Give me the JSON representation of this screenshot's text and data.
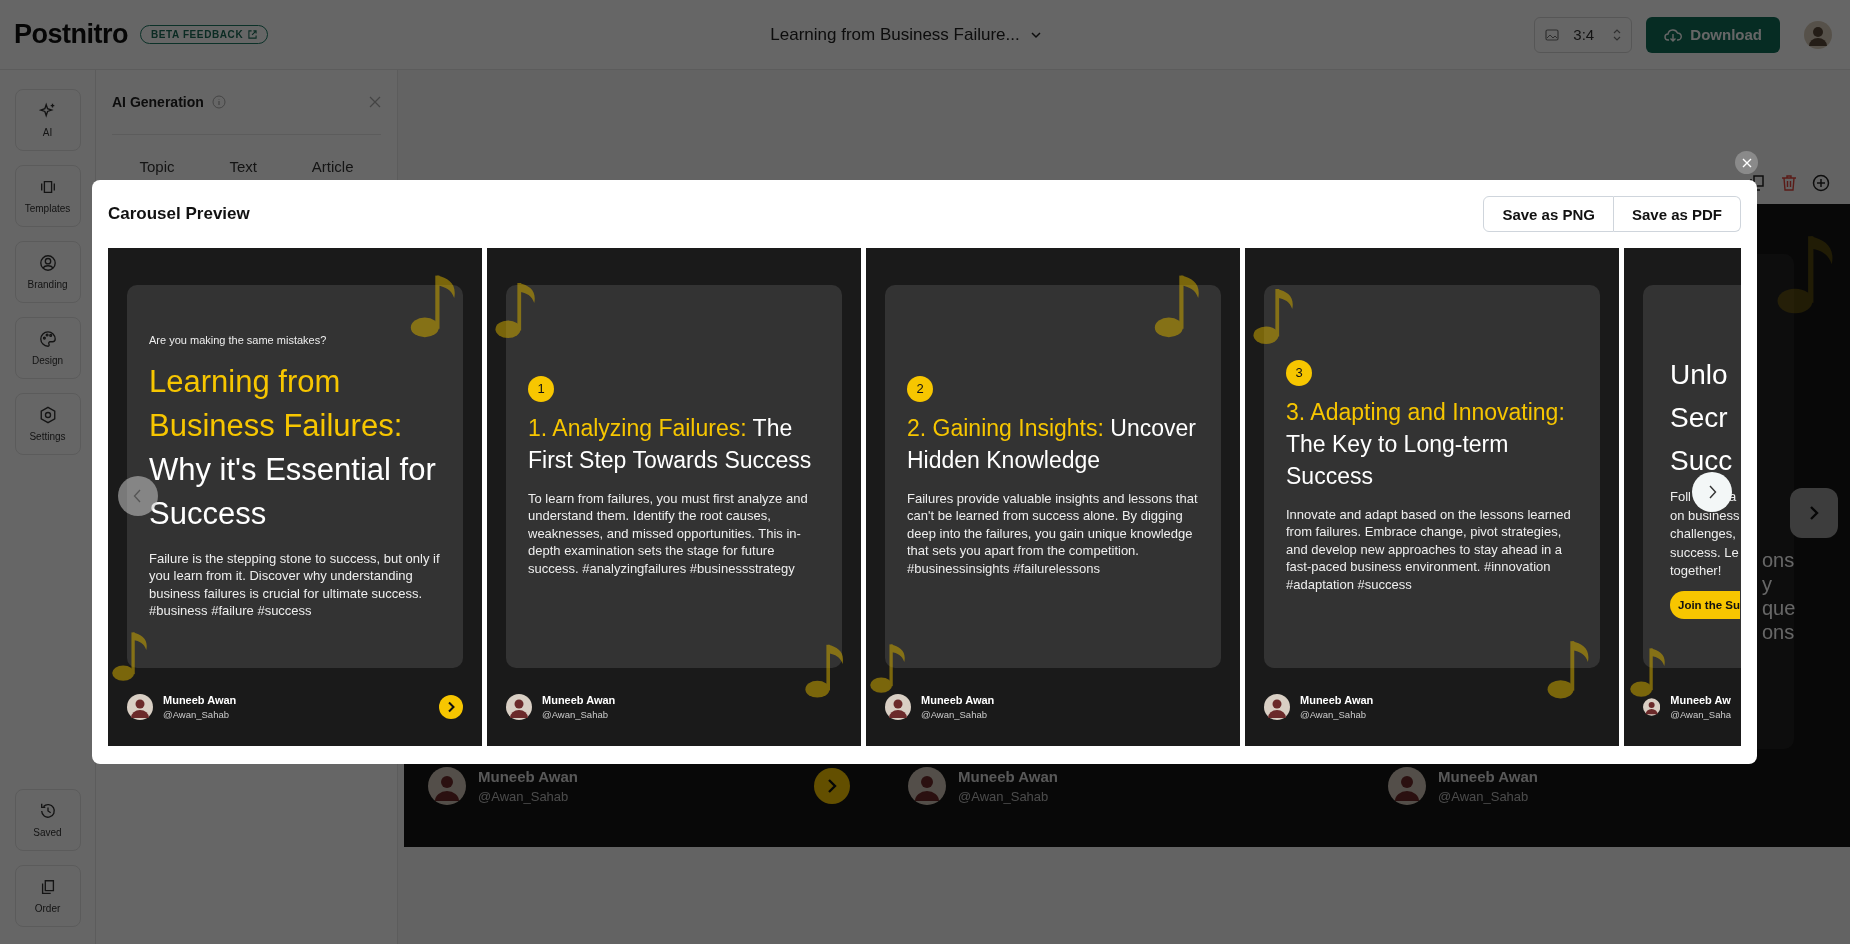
{
  "topbar": {
    "logo": "Postnitro",
    "beta_badge": "BETA FEEDBACK",
    "document_title": "Learning from Business Failure...",
    "ratio": "3:4",
    "download": "Download"
  },
  "rail_top": [
    {
      "label": "AI"
    },
    {
      "label": "Templates"
    },
    {
      "label": "Branding"
    },
    {
      "label": "Design"
    },
    {
      "label": "Settings"
    }
  ],
  "rail_bottom": [
    {
      "label": "Saved"
    },
    {
      "label": "Order"
    }
  ],
  "panel": {
    "title": "AI Generation",
    "tabs": [
      "Topic",
      "Text",
      "Article"
    ]
  },
  "background": {
    "authors": [
      {
        "name": "Muneeb Awan",
        "handle": "@Awan_Sahab"
      },
      {
        "name": "Muneeb Awan",
        "handle": "@Awan_Sahab"
      },
      {
        "name": "Muneeb Awan",
        "handle": "@Awan_Sahab"
      }
    ],
    "fragments": [
      "ons",
      "y",
      "que",
      "ons"
    ]
  },
  "modal": {
    "title": "Carousel Preview",
    "buttons": [
      "Save as PNG",
      "Save as PDF"
    ],
    "slides": [
      {
        "kind": "cover",
        "kicker": "Are you making the same mistakes?",
        "title_highlight": "Learning from Business Failures:",
        "title_rest": "Why it's Essential for Success",
        "body": "Failure is the stepping stone to success, but only if you learn from it. Discover why understanding business failures is crucial for ultimate success. #business #failure #success",
        "author": "Muneeb Awan",
        "handle": "@Awan_Sahab",
        "show_next": true
      },
      {
        "kind": "point",
        "number": "1",
        "title_highlight": "1. Analyzing Failures:",
        "title_rest": "The First Step Towards Success",
        "body": "To learn from failures, you must first analyze and understand them. Identify the root causes, weaknesses, and missed opportunities. This in-depth examination sets the stage for future success. #analyzingfailures #businessstrategy",
        "author": "Muneeb Awan",
        "handle": "@Awan_Sahab",
        "show_next": false
      },
      {
        "kind": "point",
        "number": "2",
        "title_highlight": "2. Gaining Insights:",
        "title_rest": "Uncover Hidden Knowledge",
        "body": "Failures provide valuable insights and lessons that can't be learned from success alone. By digging deep into the failures, you gain unique knowledge that sets you apart from the competition. #businessinsights #failurelessons",
        "author": "Muneeb Awan",
        "handle": "@Awan_Sahab",
        "show_next": false
      },
      {
        "kind": "point",
        "number": "3",
        "title_highlight": "3. Adapting and Innovating:",
        "title_rest": "The Key to Long-term Success",
        "body": "Innovate and adapt based on the lessons learned from failures. Embrace change, pivot strategies, and develop new approaches to stay ahead in a fast-paced business environment. #innovation #adaptation #success",
        "author": "Muneeb Awan",
        "handle": "@Awan_Sahab",
        "show_next": false
      },
      {
        "kind": "cta",
        "title_lines": [
          "Unlo",
          "Secr",
          "Succ"
        ],
        "first_line_parts": [
          "Foll",
          "a"
        ],
        "body_lines": [
          "on business",
          "challenges,",
          "success. Le",
          "together!"
        ],
        "button": "Join the Su",
        "author": "Muneeb Aw",
        "handle": "@Awan_Saha",
        "show_next": false
      }
    ]
  }
}
